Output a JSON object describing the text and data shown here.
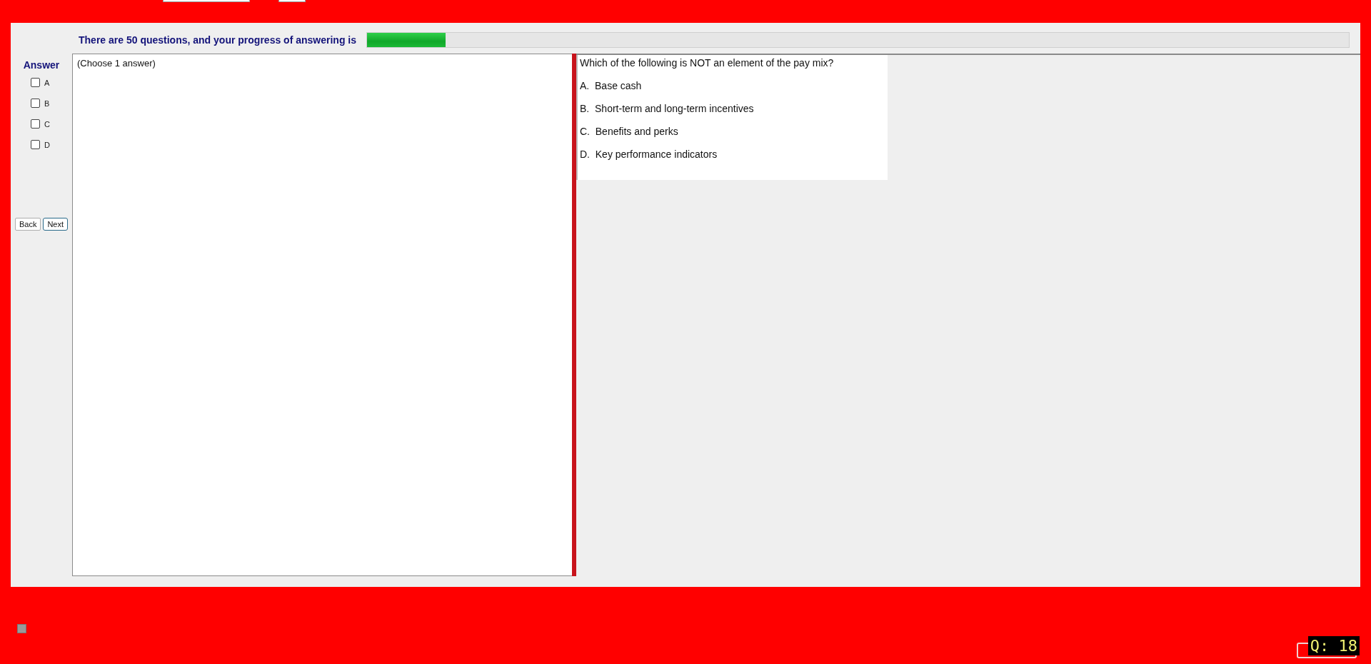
{
  "progress": {
    "label": "There are 50 questions, and your progress of answering is",
    "level": 0.08
  },
  "answer_panel": {
    "title": "Answer",
    "options": [
      {
        "label": "A",
        "checked": false
      },
      {
        "label": "B",
        "checked": false
      },
      {
        "label": "C",
        "checked": false
      },
      {
        "label": "D",
        "checked": false
      }
    ],
    "buttons": [
      {
        "label": "Back",
        "focused": false
      },
      {
        "label": "Next",
        "focused": true
      }
    ]
  },
  "instruction": "(Choose 1 answer)",
  "question": {
    "text": "Which of the following is NOT an element of the pay mix?",
    "choices": [
      {
        "letter": "A.",
        "text": "Base cash"
      },
      {
        "letter": "B.",
        "text": "Short-term and long-term incentives"
      },
      {
        "letter": "C.",
        "text": "Benefits and perks"
      },
      {
        "letter": "D.",
        "text": "Key performance indicators"
      }
    ]
  },
  "finish_checkbox": {
    "checked": false
  },
  "question_counter": "Q: 18"
}
